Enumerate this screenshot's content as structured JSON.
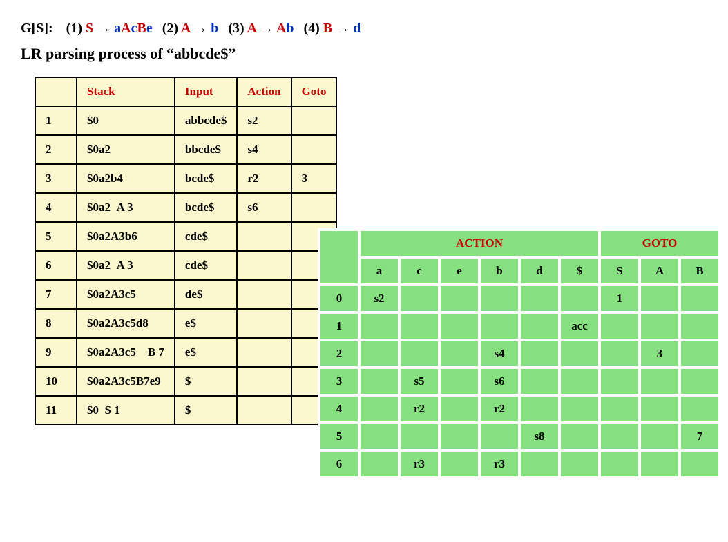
{
  "grammar": {
    "label": "G[S]:",
    "rules": [
      {
        "num": "(1)",
        "lhs": "S",
        "rhs": [
          {
            "txt": "a",
            "cls": "t"
          },
          {
            "txt": "A",
            "cls": "nt"
          },
          {
            "txt": "c",
            "cls": "t"
          },
          {
            "txt": "B",
            "cls": "nt"
          },
          {
            "txt": "e",
            "cls": "t"
          }
        ]
      },
      {
        "num": "(2)",
        "lhs": "A",
        "rhs": [
          {
            "txt": "b",
            "cls": "t"
          }
        ]
      },
      {
        "num": "(3)",
        "lhs": "A",
        "rhs": [
          {
            "txt": "A",
            "cls": "nt"
          },
          {
            "txt": "b",
            "cls": "t"
          }
        ]
      },
      {
        "num": "(4)",
        "lhs": "B",
        "rhs": [
          {
            "txt": "d",
            "cls": "t"
          }
        ]
      }
    ]
  },
  "subtitle": "LR parsing process of “abbcde$”",
  "parse": {
    "headers": [
      "",
      "Stack",
      "Input",
      "Action",
      "Goto"
    ],
    "rows": [
      {
        "step": "1",
        "stack": "$0",
        "input": "abbcde$",
        "action": "s2",
        "goto": ""
      },
      {
        "step": "2",
        "stack": "$0a2",
        "input": "bbcde$",
        "action": "s4",
        "goto": ""
      },
      {
        "step": "3",
        "stack": "$0a2b4",
        "input": "bcde$",
        "action": "r2",
        "goto": "3"
      },
      {
        "step": "4",
        "stack": "$0a2  A 3",
        "input": "bcde$",
        "action": "s6",
        "goto": ""
      },
      {
        "step": "5",
        "stack": "$0a2A3b6",
        "input": "cde$",
        "action": "",
        "goto": ""
      },
      {
        "step": "6",
        "stack": "$0a2  A 3",
        "input": "cde$",
        "action": "",
        "goto": ""
      },
      {
        "step": "7",
        "stack": "$0a2A3c5",
        "input": "de$",
        "action": "",
        "goto": ""
      },
      {
        "step": "8",
        "stack": "$0a2A3c5d8",
        "input": "e$",
        "action": "",
        "goto": ""
      },
      {
        "step": "9",
        "stack": "$0a2A3c5    B 7",
        "input": "e$",
        "action": "",
        "goto": ""
      },
      {
        "step": "10",
        "stack": "$0a2A3c5B7e9",
        "input": "$",
        "action": "",
        "goto": ""
      },
      {
        "step": "11",
        "stack": "$0  S 1",
        "input": "$",
        "action": "",
        "goto": ""
      }
    ]
  },
  "lr": {
    "action_hdr": "ACTION",
    "goto_hdr": "GOTO",
    "terminals": [
      "a",
      "c",
      "e",
      "b",
      "d",
      "$"
    ],
    "nonterminals": [
      "S",
      "A",
      "B"
    ],
    "rows": [
      {
        "state": "0",
        "cells": [
          "s2",
          "",
          "",
          "",
          "",
          "",
          "1",
          "",
          ""
        ]
      },
      {
        "state": "1",
        "cells": [
          "",
          "",
          "",
          "",
          "",
          "acc",
          "",
          "",
          ""
        ]
      },
      {
        "state": "2",
        "cells": [
          "",
          "",
          "",
          "s4",
          "",
          "",
          "",
          "3",
          ""
        ]
      },
      {
        "state": "3",
        "cells": [
          "",
          "s5",
          "",
          "s6",
          "",
          "",
          "",
          "",
          ""
        ]
      },
      {
        "state": "4",
        "cells": [
          "",
          "r2",
          "",
          "r2",
          "",
          "",
          "",
          "",
          ""
        ]
      },
      {
        "state": "5",
        "cells": [
          "",
          "",
          "",
          "",
          "s8",
          "",
          "",
          "",
          "7"
        ]
      },
      {
        "state": "6",
        "cells": [
          "",
          "r3",
          "",
          "r3",
          "",
          "",
          "",
          "",
          ""
        ]
      }
    ]
  }
}
